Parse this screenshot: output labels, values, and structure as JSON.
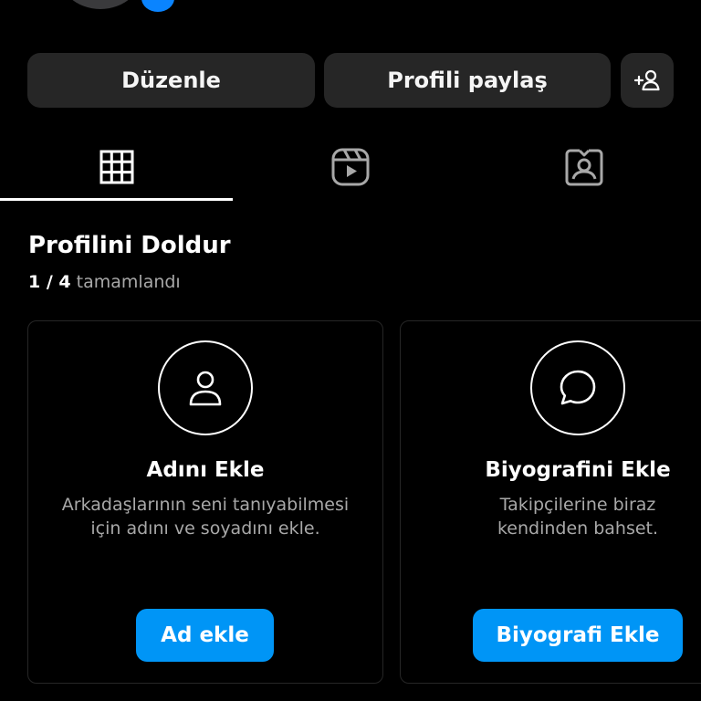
{
  "actions": {
    "edit_label": "Düzenle",
    "share_label": "Profili paylaş",
    "add_person_icon": "add-person-icon"
  },
  "tabs": [
    {
      "icon": "grid-icon",
      "selected": true
    },
    {
      "icon": "reels-icon",
      "selected": false
    },
    {
      "icon": "tagged-icon",
      "selected": false
    }
  ],
  "profile_completion": {
    "title": "Profilini Doldur",
    "completed": "1 / 4",
    "completed_suffix": "tamamlandı"
  },
  "cards": [
    {
      "icon": "person-icon",
      "title": "Adını Ekle",
      "description_lines": [
        "Arkadaşlarının seni tanıyabilmesi",
        "için adını ve soyadını ekle."
      ],
      "button_label": "Ad ekle"
    },
    {
      "icon": "speech-bubble-icon",
      "title": "Biyografini Ekle",
      "description_lines": [
        "Takipçilerine biraz",
        "kendinden bahset."
      ],
      "button_label": "Biyografi Ekle"
    }
  ],
  "colors": {
    "background": "#000000",
    "button_gray": "#262626",
    "button_blue": "#0095f6",
    "secondary_text": "#a8a8a8"
  }
}
